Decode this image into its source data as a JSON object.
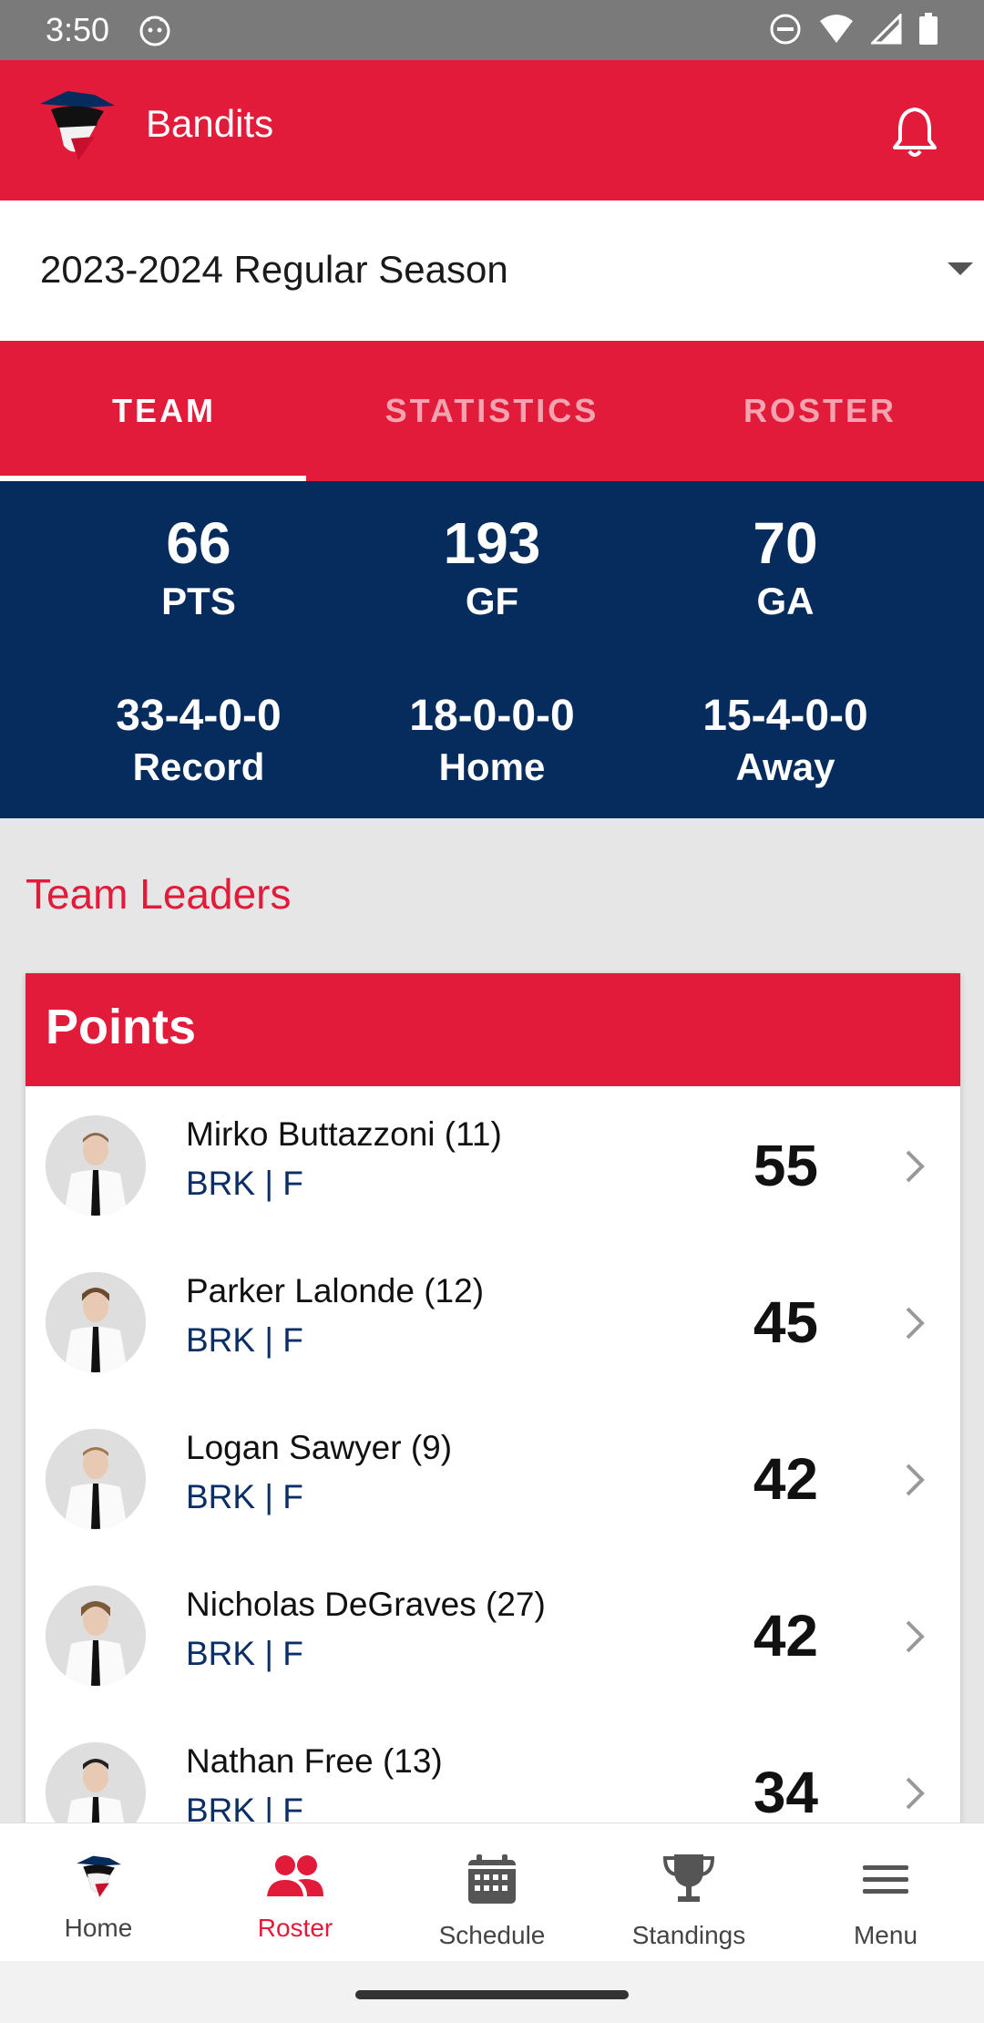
{
  "status": {
    "time": "3:50"
  },
  "header": {
    "team_name": "Bandits"
  },
  "season": {
    "selected": "2023-2024 Regular Season"
  },
  "tabs": [
    {
      "label": "TEAM",
      "active": true
    },
    {
      "label": "STATISTICS",
      "active": false
    },
    {
      "label": "ROSTER",
      "active": false
    }
  ],
  "stats": {
    "pts": {
      "value": "66",
      "label": "PTS"
    },
    "gf": {
      "value": "193",
      "label": "GF"
    },
    "ga": {
      "value": "70",
      "label": "GA"
    },
    "record": {
      "value": "33-4-0-0",
      "label": "Record"
    },
    "home": {
      "value": "18-0-0-0",
      "label": "Home"
    },
    "away": {
      "value": "15-4-0-0",
      "label": "Away"
    }
  },
  "leaders": {
    "title": "Team Leaders",
    "card_title": "Points",
    "rows": [
      {
        "name": "Mirko Buttazzoni (11)",
        "meta": "BRK | F",
        "points": "55"
      },
      {
        "name": "Parker Lalonde (12)",
        "meta": "BRK | F",
        "points": "45"
      },
      {
        "name": "Logan Sawyer (9)",
        "meta": "BRK | F",
        "points": "42"
      },
      {
        "name": "Nicholas DeGraves (27)",
        "meta": "BRK | F",
        "points": "42"
      },
      {
        "name": "Nathan Free (13)",
        "meta": "BRK | F",
        "points": "34"
      }
    ]
  },
  "nav": [
    {
      "label": "Home",
      "icon": "team-logo-icon",
      "active": false
    },
    {
      "label": "Roster",
      "icon": "people-icon",
      "active": true
    },
    {
      "label": "Schedule",
      "icon": "calendar-icon",
      "active": false
    },
    {
      "label": "Standings",
      "icon": "trophy-icon",
      "active": false
    },
    {
      "label": "Menu",
      "icon": "menu-icon",
      "active": false
    }
  ],
  "colors": {
    "brand_red": "#e31b3a",
    "navy": "#062c5e"
  }
}
